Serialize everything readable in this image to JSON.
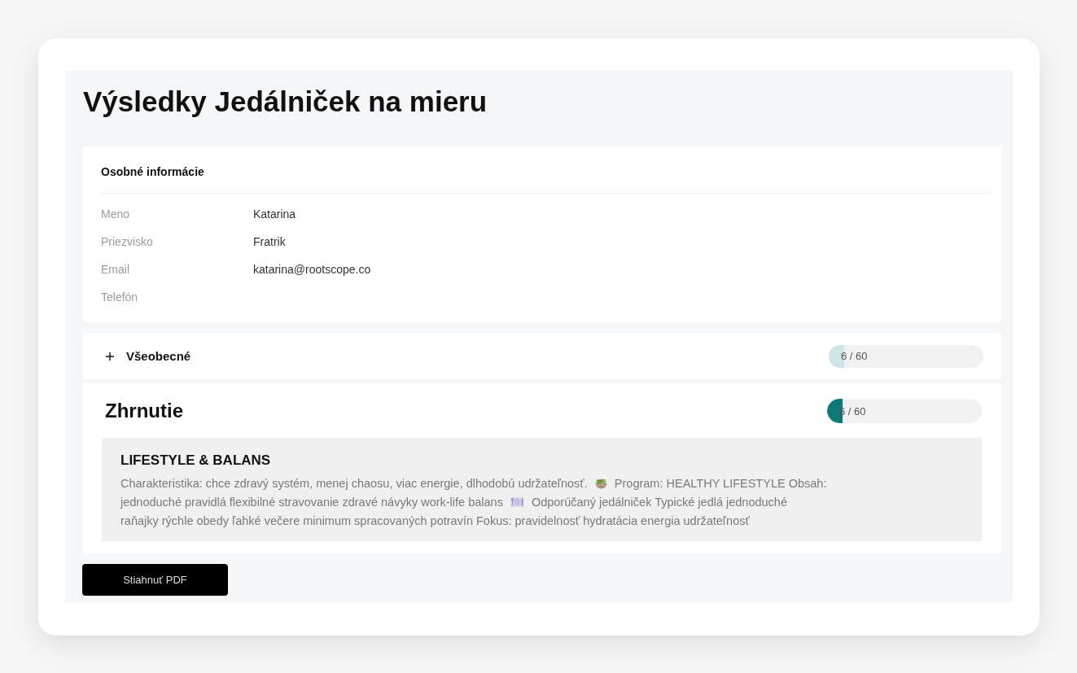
{
  "page": {
    "title": "Výsledky Jedálniček na mieru"
  },
  "personal_info": {
    "heading": "Osobné informácie",
    "fields": [
      {
        "label": "Meno",
        "value": "Katarina"
      },
      {
        "label": "Priezvisko",
        "value": "Fratrik"
      },
      {
        "label": "Email",
        "value": "katarina@rootscope.co"
      },
      {
        "label": "Telefón"
      }
    ]
  },
  "sections": [
    {
      "kind": "category",
      "title": "Všeobecné",
      "expanded": false,
      "score": {
        "text": "6 / 60",
        "level": 0.1
      }
    },
    {
      "kind": "summary",
      "title": "Zhrnutie",
      "score": {
        "text": "6 / 60",
        "level": 0.1
      },
      "result": {
        "title": "LIFESTYLE & BALANS",
        "lines": [
          [
            {
              "kind": "text",
              "text": "Charakteristika: chce zdravý systém, menej chaosu, viac energie, dlhodobú udržateľnosť."
            },
            {
              "kind": "emoji"
            },
            {
              "kind": "text",
              "text": "Program: HEALTHY LIFESTYLE Obsah:"
            }
          ],
          [
            {
              "kind": "text",
              "text": "jednoduché pravidlá flexibilné stravovanie zdravé návyky work-life balans"
            },
            {
              "kind": "emoji"
            },
            {
              "kind": "text",
              "text": "Odporúčaný jedálniček Typické jedlá jednoduché"
            }
          ],
          [
            {
              "kind": "text",
              "text": "raňajky rýchle obedy ľahké večere minimum spracovaných potravín Fokus: pravidelnosť hydratácia energia udržateľnosť"
            }
          ]
        ]
      }
    }
  ],
  "download_button": {
    "label": "Stiahnuť PDF"
  }
}
